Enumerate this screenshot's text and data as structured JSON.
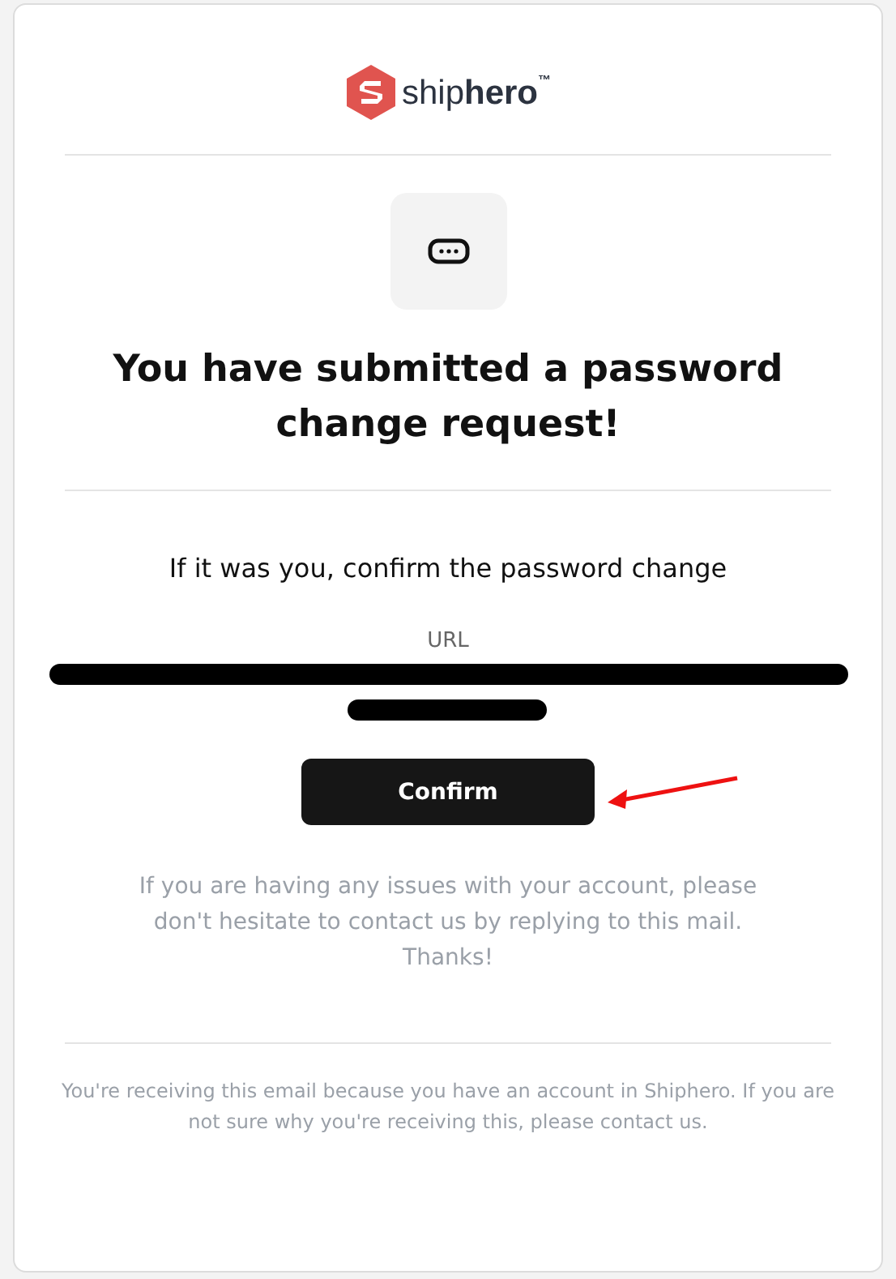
{
  "logo": {
    "wordmark": "ship**hero**$^{™}$"
  },
  "heading": "You have submitted a password change request!",
  "instruction": "If it was you, confirm the password change",
  "url_label": "URL",
  "confirm_button": "Confirm",
  "help_text": "If you are having any issues with your account, please don't hesitate to contact us by replying to this mail. Thanks!",
  "footer": "You're receiving this email because you have an account in Shiphero. If you are not sure why you're receiving this, please contact us."
}
